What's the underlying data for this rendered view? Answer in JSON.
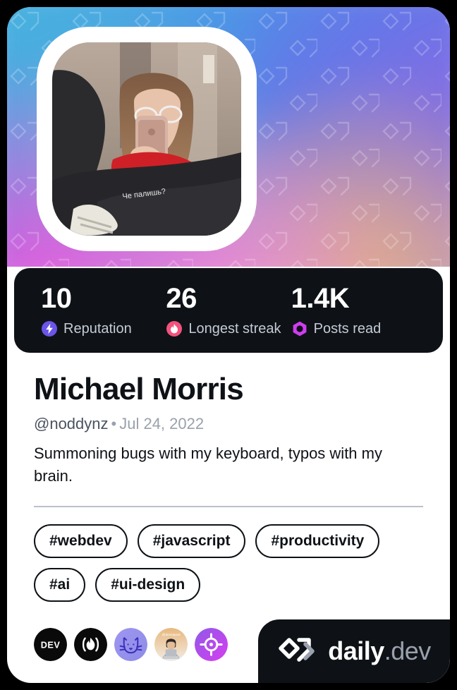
{
  "card": {
    "banner": {
      "pattern_icon": "dailydev-chevron-watermark",
      "gradient_colors": [
        "#46a8e0",
        "#4d8fe8",
        "#5b7fe8",
        "#8f7fe0",
        "#c98fd4",
        "#e0a8b8",
        "#8d82d8"
      ]
    },
    "avatar": {
      "icon": "user-avatar-photo",
      "caption": "Че палишь?"
    },
    "stats": [
      {
        "value": "10",
        "label": "Reputation",
        "icon": "bolt-icon",
        "color": "#6b55e8"
      },
      {
        "value": "26",
        "label": "Longest streak",
        "icon": "flame-icon",
        "color": "#f3527d"
      },
      {
        "value": "1.4K",
        "label": "Posts read",
        "icon": "ring-icon",
        "color": "#cf3df0"
      }
    ],
    "profile": {
      "name": "Michael Morris",
      "handle": "@noddynz",
      "separator": "•",
      "date": "Jul 24, 2022",
      "bio": "Summoning bugs with my keyboard, typos with my brain."
    },
    "tags": [
      "#webdev",
      "#javascript",
      "#productivity",
      "#ai",
      "#ui-design"
    ],
    "badges": [
      {
        "name": "dev-badge",
        "icon": "dev-logo-icon",
        "label": "DEV"
      },
      {
        "name": "streak-badge",
        "icon": "flame-parens-icon",
        "label": ""
      },
      {
        "name": "cat-badge",
        "icon": "pixel-cat-icon",
        "label": ""
      },
      {
        "name": "avatar-badge",
        "icon": "person-laptop-icon",
        "label": ""
      },
      {
        "name": "target-badge",
        "icon": "crosshair-target-icon",
        "label": ""
      }
    ],
    "logo": {
      "mark_icon": "dailydev-logo-mark",
      "text_primary": "daily",
      "text_secondary": ".dev"
    }
  }
}
